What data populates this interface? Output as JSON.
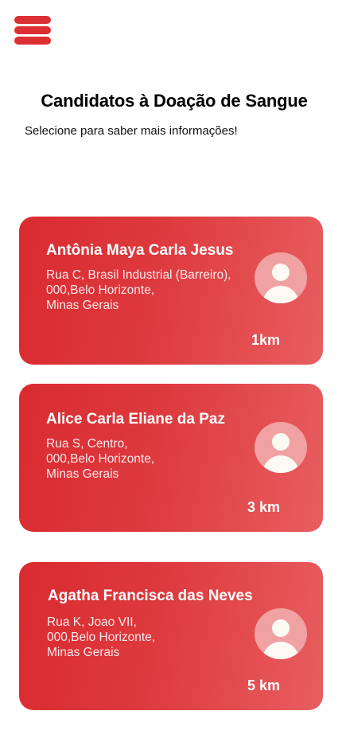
{
  "menu": {
    "icon": "hamburger-menu-icon"
  },
  "header": {
    "title": "Candidatos à Doação de Sangue",
    "subtitle": "Selecione para saber mais informações!"
  },
  "colors": {
    "accent": "#dc2f33",
    "card_gradient_start": "#d92b30",
    "card_gradient_end": "#e85e60",
    "avatar_bg": "#f0a2a3"
  },
  "candidates": [
    {
      "name": "Antônia Maya Carla Jesus",
      "address_lines": [
        "Rua C, Brasil Industrial (Barreiro),",
        "000,Belo Horizonte,",
        "Minas Gerais"
      ],
      "distance": "1km",
      "avatar_icon": "user-avatar-icon"
    },
    {
      "name": "Alice Carla Eliane da Paz",
      "address_lines": [
        "Rua S, Centro,",
        "000,Belo Horizonte,",
        "Minas Gerais"
      ],
      "distance": "3 km",
      "avatar_icon": "user-avatar-icon"
    },
    {
      "name": "Agatha Francisca das Neves",
      "address_lines": [
        "Rua K, Joao VII,",
        "000,Belo Horizonte,",
        "Minas Gerais"
      ],
      "distance": "5 km",
      "avatar_icon": "user-avatar-icon"
    }
  ]
}
